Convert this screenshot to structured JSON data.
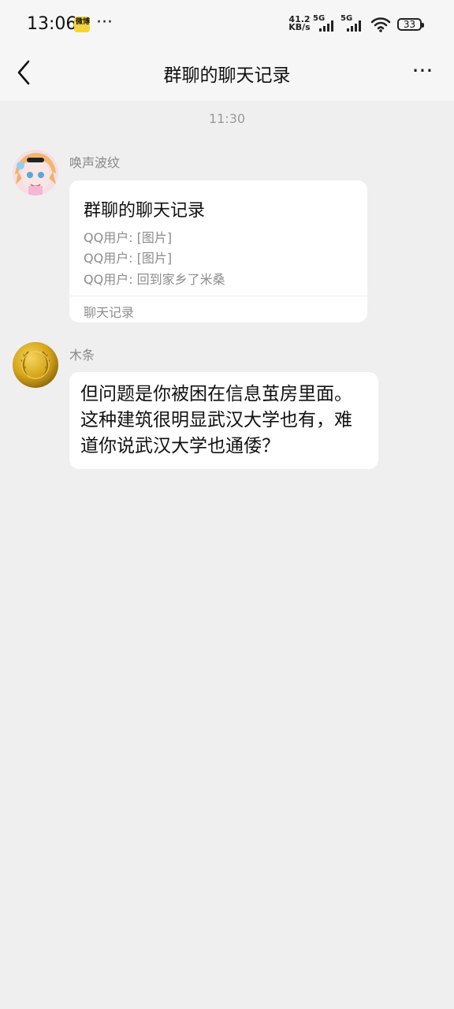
{
  "status_bar": {
    "time": "13:06",
    "app_badge": "微博",
    "overflow": "···",
    "speed_value": "41.2",
    "speed_unit": "KB/s",
    "network_1": "5G",
    "network_2": "5G",
    "battery": "33"
  },
  "header": {
    "title": "群聊的聊天记录"
  },
  "chat": {
    "timestamp": "11:30",
    "messages": [
      {
        "sender": "唤声波纹",
        "card": {
          "title": "群聊的聊天记录",
          "lines": [
            "QQ用户: [图片]",
            "QQ用户: [图片]",
            "QQ用户: 回到家乡了米桑"
          ],
          "footer": "聊天记录"
        }
      },
      {
        "sender": "木条",
        "text": "但问题是你被困在信息茧房里面。这种建筑很明显武汉大学也有，难道你说武汉大学也通倭？"
      }
    ]
  }
}
